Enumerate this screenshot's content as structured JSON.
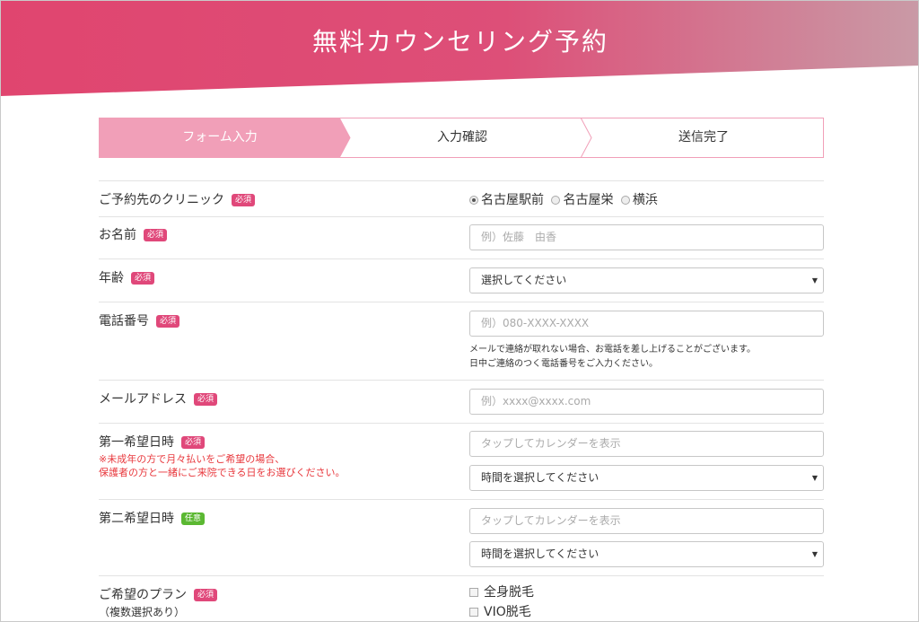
{
  "header": {
    "title": "無料カウンセリング予約"
  },
  "colors": {
    "header_start": "#e0456f",
    "header_end": "#c99aa6",
    "step_active": "#f19fb8",
    "step_border": "#f19fb8",
    "required": "#e0487a",
    "optional": "#5bb832",
    "note": "#e8383d"
  },
  "steps": [
    {
      "label": "フォーム入力",
      "active": true
    },
    {
      "label": "入力確認",
      "active": false
    },
    {
      "label": "送信完了",
      "active": false
    }
  ],
  "form": {
    "clinic": {
      "label": "ご予約先のクリニック",
      "badge": "必須",
      "options": [
        "名古屋駅前",
        "名古屋栄",
        "横浜"
      ],
      "selected": "名古屋駅前"
    },
    "name": {
      "label": "お名前",
      "badge": "必須",
      "placeholder": "例）佐藤　由香"
    },
    "age": {
      "label": "年齢",
      "badge": "必須",
      "value": "選択してください"
    },
    "phone": {
      "label": "電話番号",
      "badge": "必須",
      "placeholder": "例）080-XXXX-XXXX",
      "help_1": "メールで連絡が取れない場合、お電話を差し上げることがございます。",
      "help_2": "日中ご連絡のつく電話番号をご入力ください。"
    },
    "email": {
      "label": "メールアドレス",
      "badge": "必須",
      "placeholder": "例）xxxx@xxxx.com"
    },
    "date1": {
      "label": "第一希望日時",
      "badge": "必須",
      "note_1": "※未成年の方で月々払いをご希望の場合、",
      "note_2": "保護者の方と一緒にご来院できる日をお選びください。",
      "date_placeholder": "タップしてカレンダーを表示",
      "time_value": "時間を選択してください"
    },
    "date2": {
      "label": "第二希望日時",
      "badge": "任意",
      "date_placeholder": "タップしてカレンダーを表示",
      "time_value": "時間を選択してください"
    },
    "plan": {
      "label": "ご希望のプラン",
      "badge": "必須",
      "sub_label": "（複数選択あり）",
      "options": [
        "全身脱毛",
        "VIO脱毛"
      ]
    }
  }
}
